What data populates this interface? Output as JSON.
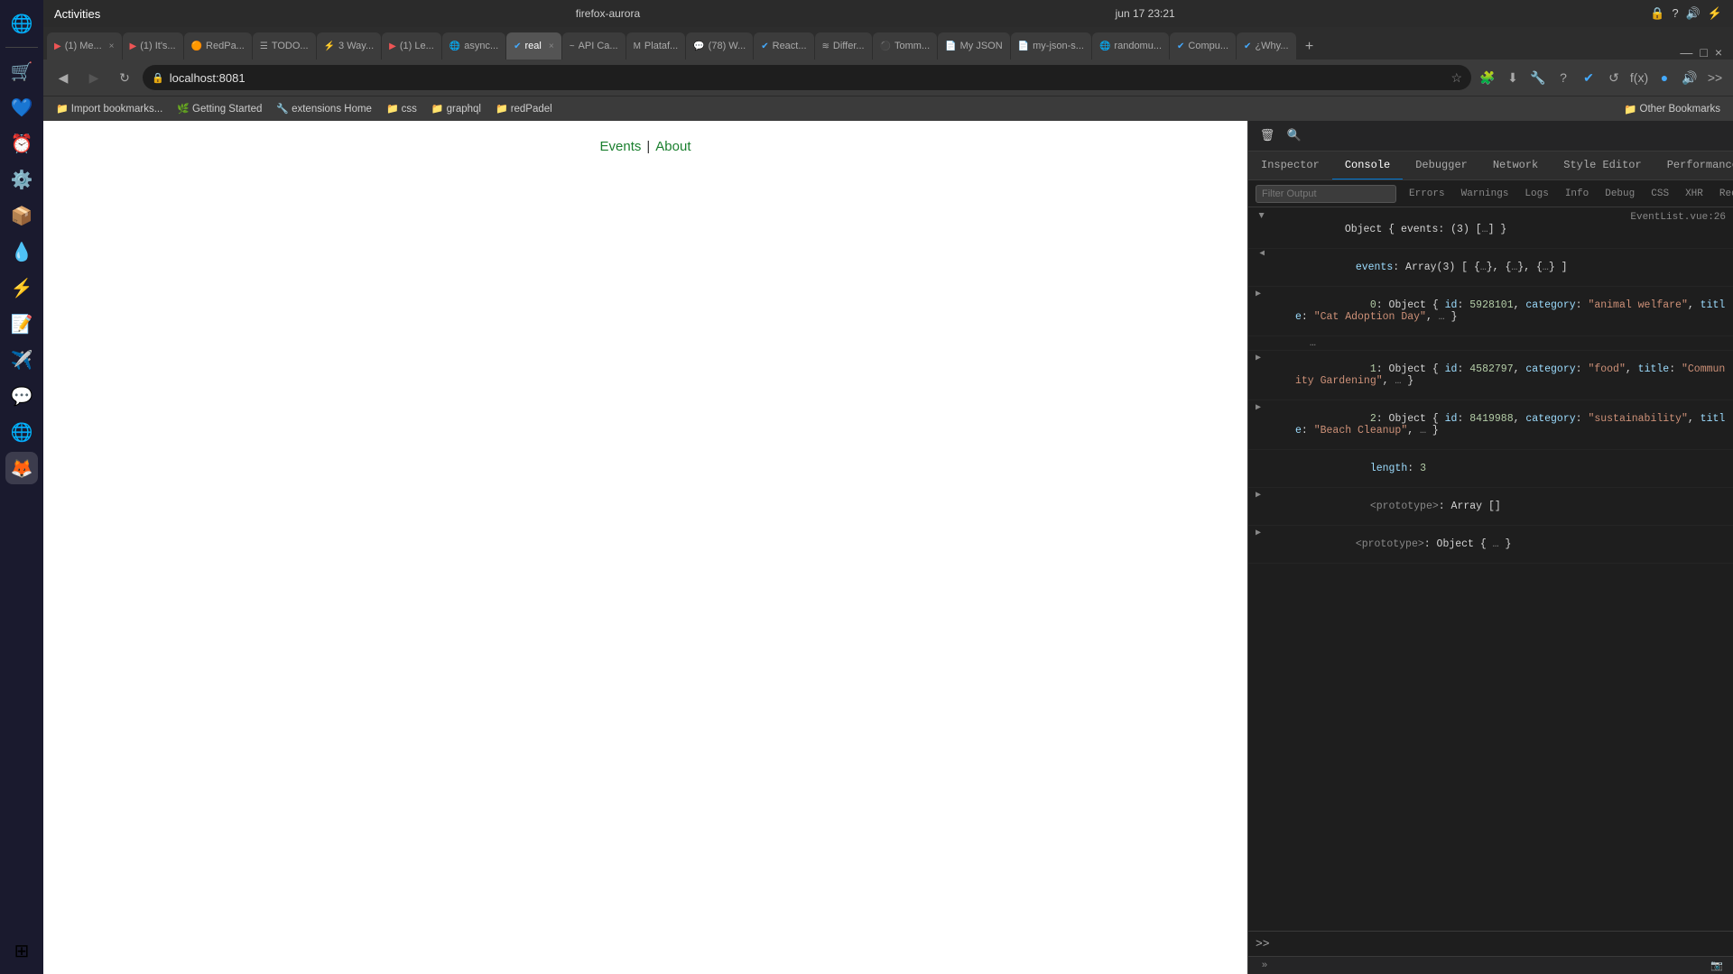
{
  "titlebar": {
    "activities": "Activities",
    "browser_name": "firefox-aurora",
    "datetime": "jun 17  23:21",
    "system_icons": [
      "🔒",
      "?",
      "🔊",
      "⚡"
    ]
  },
  "tabs": [
    {
      "id": 1,
      "favicon": "▶",
      "label": "(1) Me...",
      "active": false,
      "color": "#e55"
    },
    {
      "id": 2,
      "favicon": "▶",
      "label": "(1) It's...",
      "active": false,
      "color": "#e55"
    },
    {
      "id": 3,
      "favicon": "🟠",
      "label": "RedPa...",
      "active": false
    },
    {
      "id": 4,
      "favicon": "☰",
      "label": "TODO...",
      "active": false
    },
    {
      "id": 5,
      "favicon": "⚡",
      "label": "3 Way...",
      "active": false
    },
    {
      "id": 6,
      "favicon": "▶",
      "label": "(1) Le...",
      "active": false,
      "color": "#e55"
    },
    {
      "id": 7,
      "favicon": "🌐",
      "label": "async...",
      "active": false
    },
    {
      "id": 8,
      "favicon": "✔",
      "label": "real ×",
      "active": true
    },
    {
      "id": 9,
      "favicon": "~",
      "label": "API Ca...",
      "active": false
    },
    {
      "id": 10,
      "favicon": "M",
      "label": "Plataf...",
      "active": false
    },
    {
      "id": 11,
      "favicon": "💬",
      "label": "(78) W...",
      "active": false
    },
    {
      "id": 12,
      "favicon": "✔",
      "label": "React...",
      "active": false
    },
    {
      "id": 13,
      "favicon": "≋",
      "label": "Differ...",
      "active": false
    },
    {
      "id": 14,
      "favicon": "⚫",
      "label": "Tomm...",
      "active": false
    },
    {
      "id": 15,
      "favicon": "📄",
      "label": "My JSON...",
      "active": false
    },
    {
      "id": 16,
      "favicon": "📄",
      "label": "my-json-s...",
      "active": false
    },
    {
      "id": 17,
      "favicon": "🌐",
      "label": "randomu...",
      "active": false
    },
    {
      "id": 18,
      "favicon": "✔",
      "label": "Compu...",
      "active": false
    },
    {
      "id": 19,
      "favicon": "✔",
      "label": "¿Why...",
      "active": false
    }
  ],
  "navbar": {
    "back_disabled": false,
    "forward_disabled": true,
    "url": "localhost:8081",
    "new_tab_label": "+",
    "window_controls": [
      "—",
      "□",
      "×"
    ]
  },
  "bookmarks": [
    {
      "icon": "↓",
      "label": "Import bookmarks..."
    },
    {
      "icon": "🌿",
      "label": "Getting Started"
    },
    {
      "icon": "🔧",
      "label": "extensions Home"
    },
    {
      "icon": "📁",
      "label": "css"
    },
    {
      "icon": "📁",
      "label": "graphql"
    },
    {
      "icon": "📁",
      "label": "redPadel"
    }
  ],
  "bookmarks_other": "Other Bookmarks",
  "webpage": {
    "nav_links": [
      {
        "label": "Events",
        "href": "#",
        "active": true
      },
      {
        "label": "About",
        "href": "#",
        "active": false
      }
    ],
    "separator": "|"
  },
  "devtools": {
    "toolbar_buttons": [
      "🗑",
      "🔍"
    ],
    "tabs": [
      "Inspector",
      "Console",
      "Debugger",
      "Network",
      "Style Editor",
      "Performance"
    ],
    "active_tab": "Console",
    "more_tabs": "»",
    "extra_icons": [
      "📷",
      "☰",
      "×"
    ],
    "filter_placeholder": "Filter Output",
    "filter_tabs": [
      "Errors",
      "Warnings",
      "Logs",
      "Info",
      "Debug",
      "CSS",
      "XHR",
      "Requests"
    ],
    "active_filter": "",
    "console_source": "EventList.vue:26",
    "console_lines": [
      {
        "indent": 0,
        "expanded": true,
        "arrow": "▶",
        "text": "Object { events: (3) […] }",
        "source": "EventList.vue:26"
      },
      {
        "indent": 1,
        "expanded": true,
        "arrow": "▼",
        "text": "▼ events: Array(3) [ {…}, {…}, {…} ]"
      },
      {
        "indent": 2,
        "expanded": true,
        "arrow": "▶",
        "text": "▶ 0: Object { id: 5928101, category: \"animal welfare\", title: \"Cat Adoption Day\", … }"
      },
      {
        "indent": 2,
        "arrow": "",
        "text": "▶ …"
      },
      {
        "indent": 2,
        "expanded": false,
        "arrow": "▶",
        "text": "▶ 1: Object { id: 4582797, category: \"food\", title: \"Community Gardening\", … }"
      },
      {
        "indent": 2,
        "expanded": false,
        "arrow": "▶",
        "text": "▶ 2: Object { id: 8419988, category: \"sustainability\", title: \"Beach Cleanup\", … }"
      },
      {
        "indent": 2,
        "arrow": "",
        "text": "  length: 3"
      },
      {
        "indent": 2,
        "arrow": "",
        "text": "  ▶ <prototype>: Array []"
      },
      {
        "indent": 1,
        "arrow": "",
        "text": "▶ <prototype>: Object { … }"
      }
    ],
    "bottom_buttons": [
      "»",
      "📷"
    ]
  },
  "taskbar_apps": [
    {
      "icon": "🌐",
      "name": "globe"
    },
    {
      "icon": "🛒",
      "name": "shop"
    },
    {
      "icon": "💬",
      "name": "discord"
    },
    {
      "icon": "⏰",
      "name": "clock"
    },
    {
      "icon": "⚙️",
      "name": "settings"
    },
    {
      "icon": "📦",
      "name": "package"
    },
    {
      "icon": "🌱",
      "name": "dropbox"
    },
    {
      "icon": "💻",
      "name": "vscode"
    },
    {
      "icon": "📝",
      "name": "writer"
    },
    {
      "icon": "✈️",
      "name": "telegram"
    },
    {
      "icon": "💬",
      "name": "slack"
    },
    {
      "icon": "🌐",
      "name": "chrome"
    },
    {
      "icon": "🦊",
      "name": "firefox"
    },
    {
      "icon": "⊞",
      "name": "apps"
    }
  ]
}
